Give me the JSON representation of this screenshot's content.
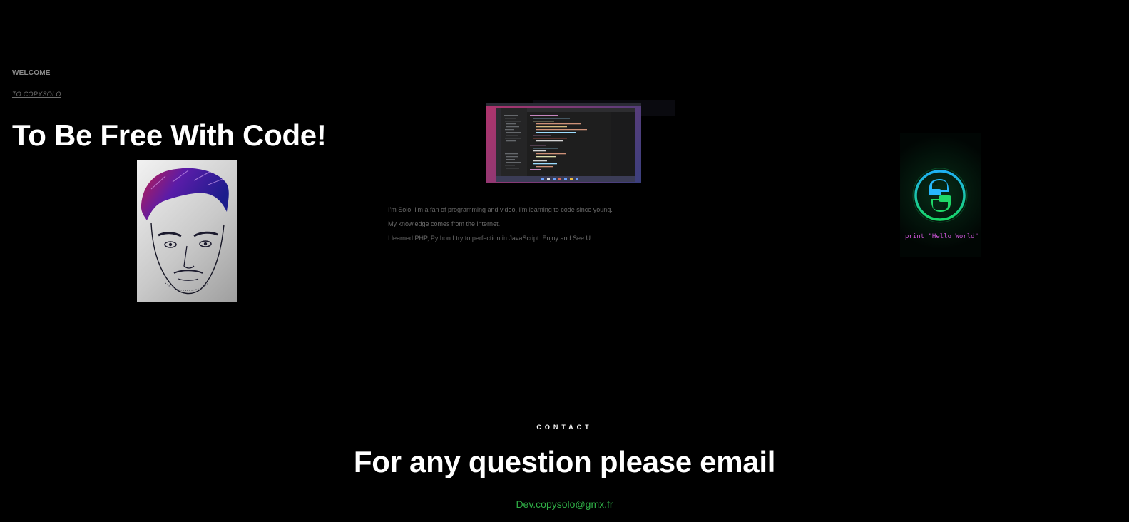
{
  "header": {
    "welcome": "WELCOME",
    "brand_link": "TO COPYSOLO"
  },
  "hero": {
    "title": "To Be Free With Code!"
  },
  "about": {
    "lines": [
      "I'm Solo, I'm a fan of programming and video, I'm learning to code since young.",
      "My knowledge comes from the internet.",
      "I learned PHP, Python I try to perfection in JavaScript. Enjoy and See U"
    ]
  },
  "python_card": {
    "caption": "print \"Hello World\""
  },
  "contact": {
    "kicker": "CONTACT",
    "title": "For any question please email",
    "email": "Dev.copysolo@gmx.fr"
  },
  "colors": {
    "background": "#000000",
    "email_green": "#2fae46",
    "python_ring": "#19d66a"
  }
}
